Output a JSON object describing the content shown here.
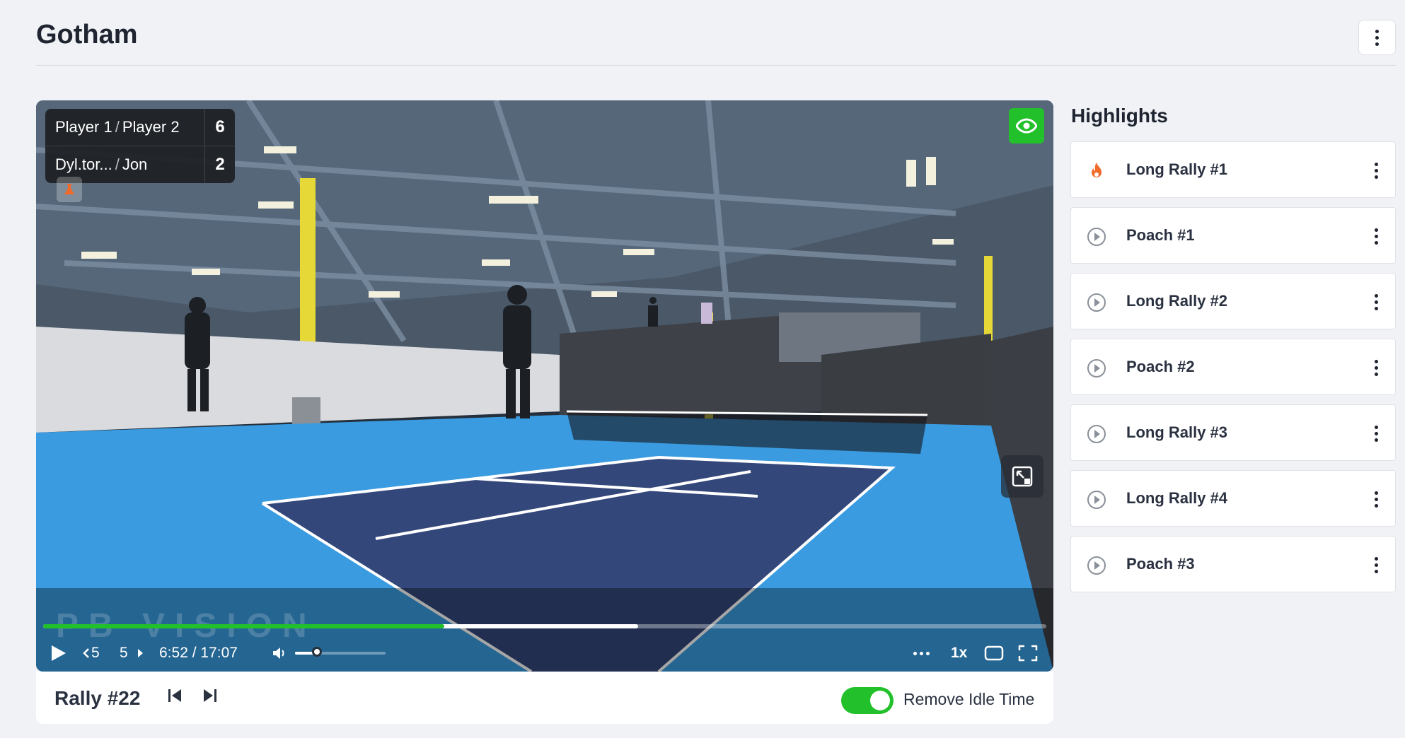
{
  "page": {
    "title": "Gotham"
  },
  "scoreboard": {
    "rows": [
      {
        "name_a": "Player 1",
        "name_b": "Player 2",
        "score": "6"
      },
      {
        "name_a": "Dyl.tor...",
        "name_b": "Jon",
        "score": "2"
      }
    ]
  },
  "video": {
    "watermark": "PB VISION",
    "played_fraction": 0.4,
    "buffered_fraction": 0.593,
    "volume_fraction": 0.24,
    "controls": {
      "skip_back": "5",
      "skip_forward": "5",
      "time": "6:52 / 17:07",
      "speed": "1x"
    }
  },
  "rally": {
    "title": "Rally #22",
    "idle_label": "Remove Idle Time",
    "idle_enabled": true
  },
  "highlights": {
    "title": "Highlights",
    "items": [
      {
        "label": "Long Rally #1",
        "icon": "fire-icon"
      },
      {
        "label": "Poach #1",
        "icon": "play-circle-icon"
      },
      {
        "label": "Long Rally #2",
        "icon": "play-circle-icon"
      },
      {
        "label": "Poach #2",
        "icon": "play-circle-icon"
      },
      {
        "label": "Long Rally #3",
        "icon": "play-circle-icon"
      },
      {
        "label": "Long Rally #4",
        "icon": "play-circle-icon"
      },
      {
        "label": "Poach #3",
        "icon": "play-circle-icon"
      }
    ]
  },
  "colors": {
    "accent": "#22c02a",
    "court_blue": "#3a9be0",
    "court_navy": "#34477a",
    "fire": "#f06a2a"
  }
}
